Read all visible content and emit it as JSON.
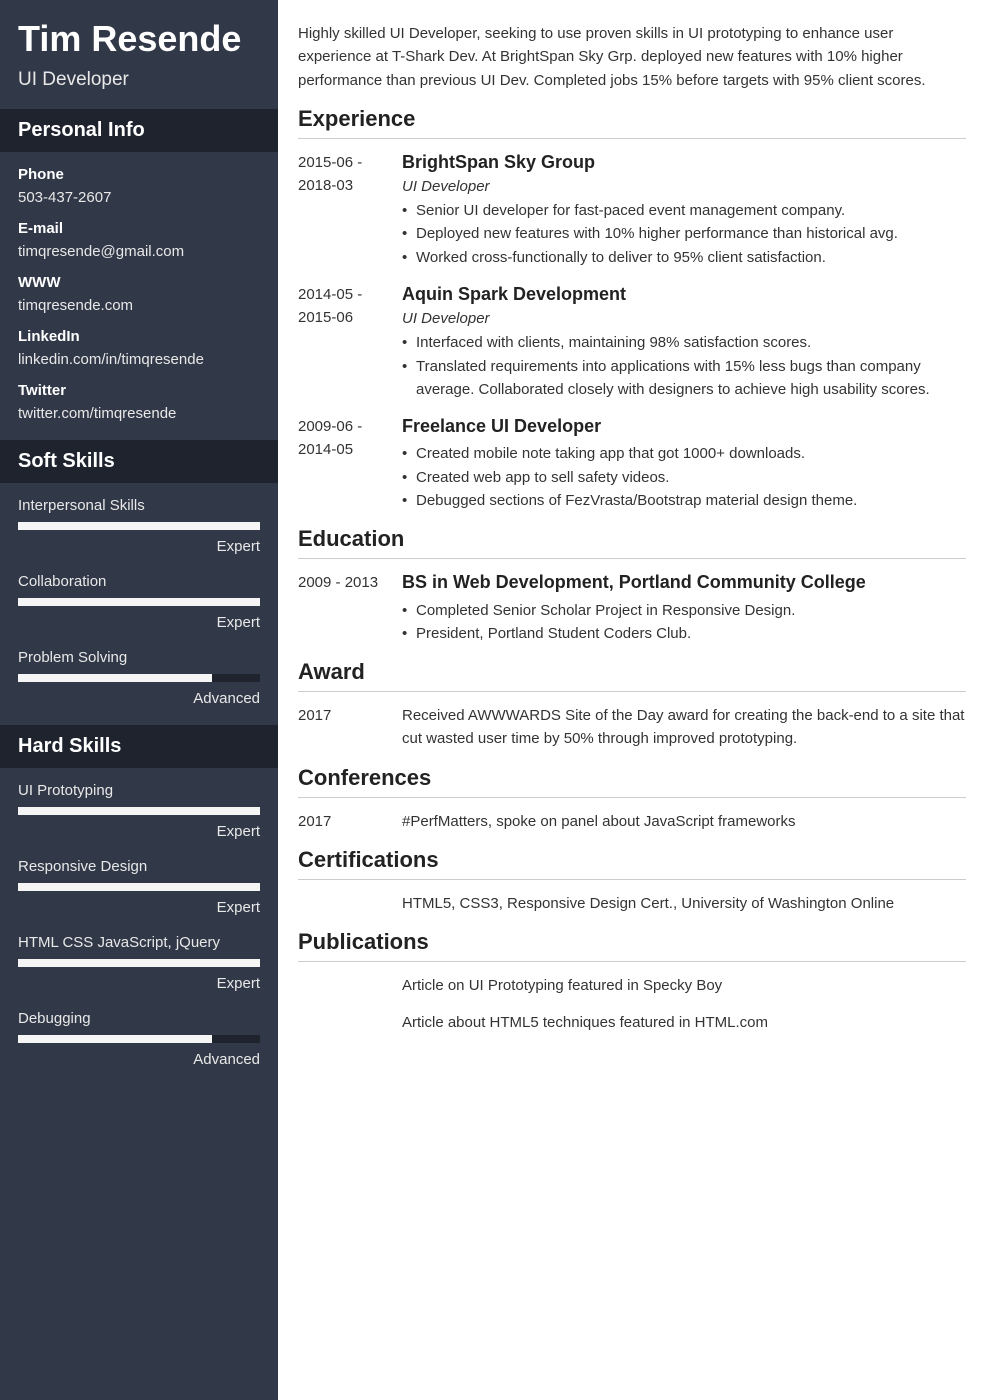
{
  "header": {
    "name": "Tim Resende",
    "title": "UI Developer"
  },
  "personal_info": {
    "heading": "Personal Info",
    "items": [
      {
        "label": "Phone",
        "value": "503-437-2607"
      },
      {
        "label": "E-mail",
        "value": "timqresende@gmail.com"
      },
      {
        "label": "WWW",
        "value": "timqresende.com"
      },
      {
        "label": "LinkedIn",
        "value": "linkedin.com/in/timqresende"
      },
      {
        "label": "Twitter",
        "value": "twitter.com/timqresende"
      }
    ]
  },
  "soft_skills": {
    "heading": "Soft Skills",
    "items": [
      {
        "name": "Interpersonal Skills",
        "level": "Expert",
        "pct": 100
      },
      {
        "name": "Collaboration",
        "level": "Expert",
        "pct": 100
      },
      {
        "name": "Problem Solving",
        "level": "Advanced",
        "pct": 80
      }
    ]
  },
  "hard_skills": {
    "heading": "Hard Skills",
    "items": [
      {
        "name": "UI Prototyping",
        "level": "Expert",
        "pct": 100
      },
      {
        "name": "Responsive Design",
        "level": "Expert",
        "pct": 100
      },
      {
        "name": "HTML CSS JavaScript, jQuery",
        "level": "Expert",
        "pct": 100
      },
      {
        "name": "Debugging",
        "level": "Advanced",
        "pct": 80
      }
    ]
  },
  "summary": "Highly skilled UI Developer, seeking to use proven skills in UI prototyping to enhance user experience at T-Shark Dev. At BrightSpan Sky Grp. deployed new features with 10% higher performance than previous UI Dev. Completed jobs 15% before targets with 95% client scores.",
  "experience": {
    "heading": "Experience",
    "items": [
      {
        "dates": "2015-06 - 2018-03",
        "company": "BrightSpan Sky Group",
        "role": "UI Developer",
        "bullets": [
          "Senior UI developer for fast-paced event management company.",
          "Deployed new features with 10% higher performance than historical avg.",
          "Worked cross-functionally to deliver to 95% client satisfaction."
        ]
      },
      {
        "dates": "2014-05 - 2015-06",
        "company": "Aquin Spark Development",
        "role": "UI Developer",
        "bullets": [
          "Interfaced with clients, maintaining 98% satisfaction scores.",
          "Translated requirements into applications with 15% less bugs than company average. Collaborated closely with designers to achieve high usability scores."
        ]
      },
      {
        "dates": "2009-06 - 2014-05",
        "company": "Freelance UI Developer",
        "role": "",
        "bullets": [
          "Created mobile note taking app that got 1000+ downloads.",
          "Created web app to sell safety videos.",
          "Debugged sections of FezVrasta/Bootstrap material design theme."
        ]
      }
    ]
  },
  "education": {
    "heading": "Education",
    "items": [
      {
        "dates": "2009 - 2013",
        "title": "BS in Web Development, Portland Community College",
        "bullets": [
          "Completed Senior Scholar Project in Responsive Design.",
          "President, Portland Student Coders Club."
        ]
      }
    ]
  },
  "award": {
    "heading": "Award",
    "items": [
      {
        "dates": "2017",
        "text": "Received AWWWARDS Site of the Day award for creating the back-end to a site that cut wasted user time by 50% through improved prototyping."
      }
    ]
  },
  "conferences": {
    "heading": "Conferences",
    "items": [
      {
        "dates": "2017",
        "text": "#PerfMatters, spoke on panel about JavaScript frameworks"
      }
    ]
  },
  "certifications": {
    "heading": "Certifications",
    "items": [
      {
        "dates": "",
        "text": "HTML5, CSS3, Responsive Design Cert., University of Washington Online"
      }
    ]
  },
  "publications": {
    "heading": "Publications",
    "items": [
      {
        "dates": "",
        "text": "Article on UI Prototyping featured in Specky Boy"
      },
      {
        "dates": "",
        "text": "Article about HTML5 techniques featured in HTML.com"
      }
    ]
  }
}
